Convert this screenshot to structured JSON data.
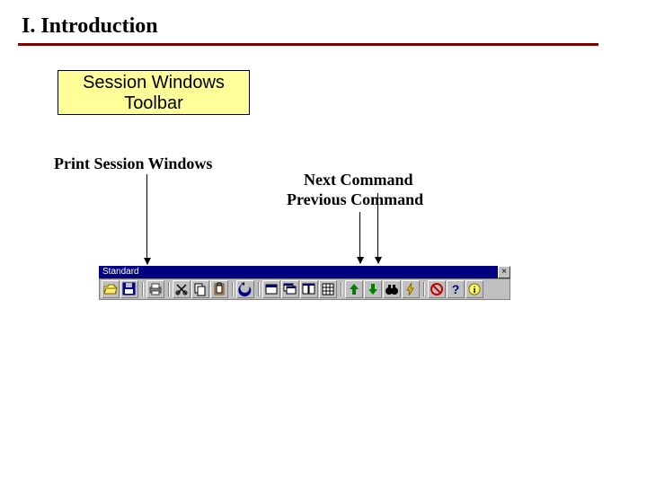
{
  "heading": "I. Introduction",
  "title_box": {
    "line1": "Session Windows",
    "line2": "Toolbar"
  },
  "labels": {
    "print": "Print Session Windows",
    "next": "Next Command",
    "prev": "Previous Command"
  },
  "toolbar": {
    "title": "Standard",
    "close_glyph": "×",
    "groups": [
      {
        "items": [
          {
            "id": "open",
            "icon": "folder-open-icon"
          },
          {
            "id": "save",
            "icon": "floppy-icon"
          }
        ]
      },
      {
        "items": [
          {
            "id": "print",
            "icon": "printer-icon"
          }
        ]
      },
      {
        "items": [
          {
            "id": "cut",
            "icon": "scissors-icon"
          },
          {
            "id": "copy",
            "icon": "copy-icon"
          },
          {
            "id": "paste",
            "icon": "clipboard-icon"
          }
        ]
      },
      {
        "items": [
          {
            "id": "undo",
            "icon": "undo-icon"
          }
        ]
      },
      {
        "items": [
          {
            "id": "win1",
            "icon": "window-icon"
          },
          {
            "id": "win2",
            "icon": "window-stack-icon"
          },
          {
            "id": "win3",
            "icon": "tile-icon"
          },
          {
            "id": "grid",
            "icon": "grid-icon"
          }
        ]
      },
      {
        "items": [
          {
            "id": "prev",
            "icon": "arrow-up-icon"
          },
          {
            "id": "next",
            "icon": "arrow-down-icon"
          },
          {
            "id": "find",
            "icon": "binoculars-icon"
          },
          {
            "id": "bolt",
            "icon": "bolt-icon"
          }
        ]
      },
      {
        "items": [
          {
            "id": "stop",
            "icon": "no-entry-icon"
          },
          {
            "id": "help",
            "icon": "question-icon"
          },
          {
            "id": "about",
            "icon": "info-icon"
          }
        ]
      }
    ]
  }
}
